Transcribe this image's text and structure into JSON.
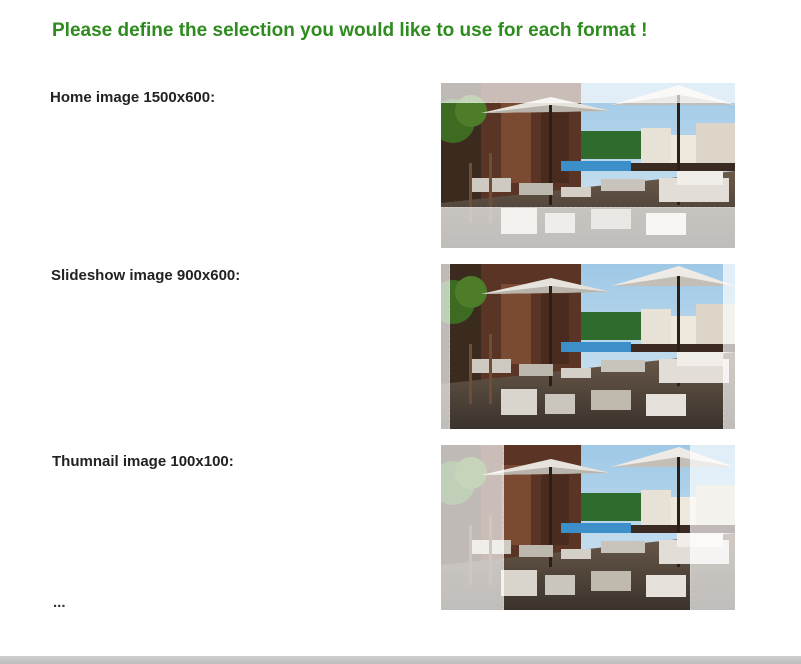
{
  "page": {
    "heading": "Please define the selection you would like to use for each format !",
    "ellipsis": "..."
  },
  "formats": [
    {
      "label": "Home image 1500x600:"
    },
    {
      "label": "Slideshow image 900x600:"
    },
    {
      "label": "Thumnail image 100x100:"
    }
  ],
  "theme": {
    "heading_color": "#2e8b1e",
    "mask_color": "#ffffff"
  }
}
